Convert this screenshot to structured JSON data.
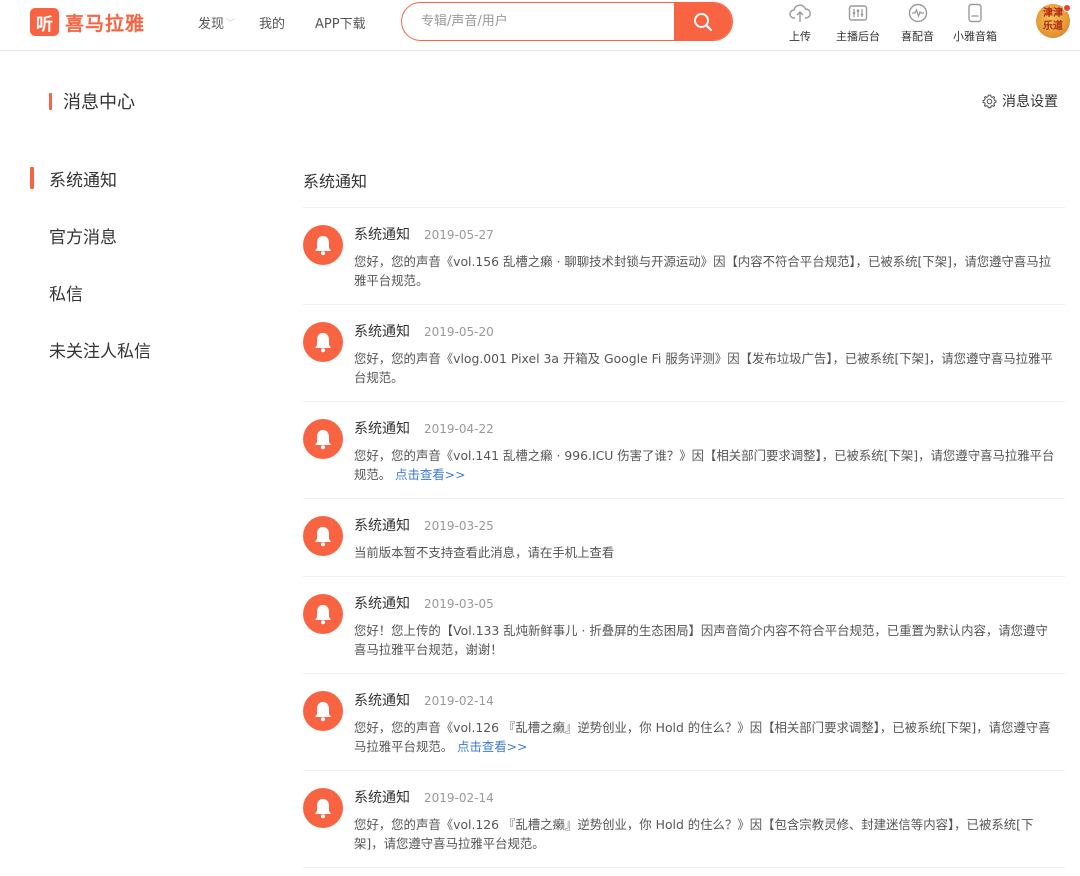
{
  "header": {
    "logo_mark": "听",
    "logo_text": "喜马拉雅",
    "nav": [
      {
        "label": "发现"
      },
      {
        "label": "我的"
      },
      {
        "label": "APP下载"
      }
    ],
    "nav_arrow": "﹀",
    "search_placeholder": "专辑/声音/用户",
    "tools": [
      {
        "label": "上传",
        "icon": "upload-cloud-icon"
      },
      {
        "label": "主播后台",
        "icon": "mixer-icon"
      },
      {
        "label": "喜配音",
        "icon": "waveform-icon"
      },
      {
        "label": "小雅音箱",
        "icon": "speaker-icon"
      }
    ],
    "avatar_text": "津津乐道",
    "accent_color": "#f86442"
  },
  "page": {
    "title": "消息中心",
    "settings_label": "消息设置"
  },
  "sidebar": {
    "items": [
      {
        "label": "系统通知",
        "active": true
      },
      {
        "label": "官方消息",
        "active": false
      },
      {
        "label": "私信",
        "active": false
      },
      {
        "label": "未关注人私信",
        "active": false
      }
    ]
  },
  "main": {
    "title": "系统通知",
    "messages": [
      {
        "name": "系统通知",
        "date": "2019-05-27",
        "body": "您好，您的声音《vol.156 乱槽之癞 · 聊聊技术封锁与开源运动》因【内容不符合平台规范】，已被系统[下架]，请您遵守喜马拉雅平台规范。",
        "link": ""
      },
      {
        "name": "系统通知",
        "date": "2019-05-20",
        "body": "您好，您的声音《vlog.001 Pixel 3a 开箱及 Google Fi 服务评测》因【发布垃圾广告】，已被系统[下架]，请您遵守喜马拉雅平台规范。",
        "link": ""
      },
      {
        "name": "系统通知",
        "date": "2019-04-22",
        "body": "您好，您的声音《vol.141 乱槽之癞 · 996.ICU 伤害了谁？》因【相关部门要求调整】，已被系统[下架]，请您遵守喜马拉雅平台规范。",
        "link": "点击查看>>"
      },
      {
        "name": "系统通知",
        "date": "2019-03-25",
        "body": "当前版本暂不支持查看此消息，请在手机上查看",
        "link": ""
      },
      {
        "name": "系统通知",
        "date": "2019-03-05",
        "body": "您好！您上传的【Vol.133 乱炖新鲜事儿 · 折叠屏的生态困局】因声音简介内容不符合平台规范，已重置为默认内容，请您遵守喜马拉雅平台规范，谢谢！",
        "link": ""
      },
      {
        "name": "系统通知",
        "date": "2019-02-14",
        "body": "您好，您的声音《vol.126 『乱槽之癞』逆势创业，你 Hold 的住么？》因【相关部门要求调整】，已被系统[下架]，请您遵守喜马拉雅平台规范。",
        "link": "点击查看>>"
      },
      {
        "name": "系统通知",
        "date": "2019-02-14",
        "body": "您好，您的声音《vol.126 『乱槽之癞』逆势创业，你 Hold 的住么？》因【包含宗教灵修、封建迷信等内容】，已被系统[下架]，请您遵守喜马拉雅平台规范。",
        "link": ""
      }
    ]
  }
}
